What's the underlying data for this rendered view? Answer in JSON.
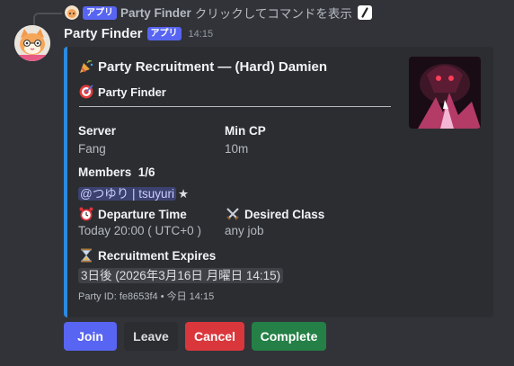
{
  "reply": {
    "badge": "アプリ",
    "name": "Party Finder",
    "text": "クリックしてコマンドを表示"
  },
  "message": {
    "author": "Party Finder",
    "badge": "アプリ",
    "timestamp": "14:15"
  },
  "embed": {
    "accent_color": "#2b8ae0",
    "title": "Party Recruitment — (Hard) Damien",
    "author": "Party Finder",
    "divider": "———————————————————————",
    "fields": {
      "server_name": "Server",
      "server_value": "Fang",
      "mincp_name": "Min CP",
      "mincp_value": "10m",
      "members_name": "Members  1/6",
      "member_mention": "@つゆり | tsuyuri",
      "member_star": "★",
      "departure_name": "Departure Time",
      "departure_value": "Today 20:00 ( UTC+0 )",
      "class_name": "Desired Class",
      "class_value": "any job",
      "expires_name": "Recruitment Expires",
      "expires_relative": "3日後",
      "expires_absolute": "(2026年3月16日 月曜日 14:15)"
    },
    "footer": "Party ID: fe8653f4 • 今日 14:15"
  },
  "buttons": {
    "join": "Join",
    "leave": "Leave",
    "cancel": "Cancel",
    "complete": "Complete"
  },
  "icons": {
    "title": "party-popper-icon",
    "author": "target-icon",
    "departure": "alarm-clock-icon",
    "class": "crossed-swords-icon",
    "expires": "hourglass-icon"
  }
}
